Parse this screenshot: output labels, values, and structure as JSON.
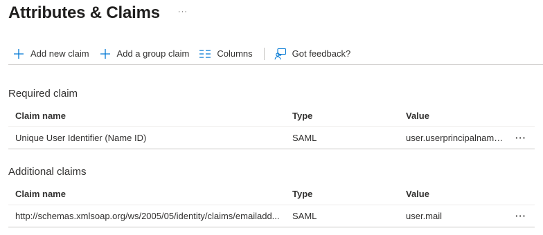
{
  "header": {
    "title": "Attributes & Claims",
    "more_label": "···"
  },
  "toolbar": {
    "add_new_claim": "Add new claim",
    "add_group_claim": "Add a group claim",
    "columns": "Columns",
    "got_feedback": "Got feedback?"
  },
  "required_claim": {
    "title": "Required claim",
    "columns": {
      "name": "Claim name",
      "type": "Type",
      "value": "Value"
    },
    "rows": [
      {
        "name": "Unique User Identifier (Name ID)",
        "type": "SAML",
        "value": "user.userprincipalname [...",
        "more": "···"
      }
    ]
  },
  "additional_claims": {
    "title": "Additional claims",
    "columns": {
      "name": "Claim name",
      "type": "Type",
      "value": "Value"
    },
    "rows": [
      {
        "name": "http://schemas.xmlsoap.org/ws/2005/05/identity/claims/emailadd...",
        "type": "SAML",
        "value": "user.mail",
        "more": "···"
      }
    ]
  },
  "colors": {
    "accent": "#0078d4",
    "text": "#323130",
    "divider": "#c8c6c4"
  },
  "icons": {
    "add": "plus-icon",
    "columns": "columns-icon",
    "feedback": "feedback-person-icon",
    "more": "ellipsis-icon"
  }
}
